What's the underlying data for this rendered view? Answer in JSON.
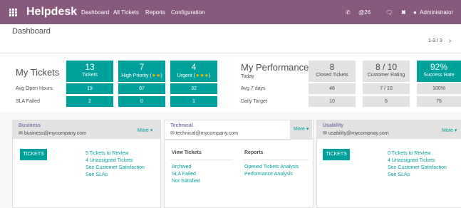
{
  "topbar": {
    "brand": "Helpdesk",
    "menu": [
      "Dashboard",
      "All Tickets",
      "Reports",
      "Configuration"
    ],
    "phone_icon": "phone-icon",
    "activity_count": "@26",
    "chat_icon": "chat-icon",
    "close_icon": "close-icon",
    "user": "Administrator"
  },
  "subhead": {
    "title": "Dashboard",
    "pager": "1-3 / 3"
  },
  "my_tickets": {
    "title": "My Tickets",
    "tiles": [
      {
        "num": "13",
        "label": "Tickets"
      },
      {
        "num": "7",
        "label": "High Priority",
        "stars": "★★"
      },
      {
        "num": "4",
        "label": "Urgent",
        "stars": "★★★"
      }
    ],
    "rows": [
      {
        "label": "Avg Open Hours",
        "values": [
          "19",
          "87",
          "32"
        ]
      },
      {
        "label": "SLA Failed",
        "values": [
          "2",
          "0",
          "1"
        ]
      }
    ]
  },
  "my_performance": {
    "title": "My Performance",
    "subtitle": "Today",
    "tiles": [
      {
        "num": "8",
        "label": "Closed Tickets"
      },
      {
        "num": "8 / 10",
        "label": "Customer Rating"
      },
      {
        "num": "92%",
        "label": "Success Rate"
      }
    ],
    "rows": [
      {
        "label": "Avg 7 days",
        "values": [
          "46",
          "7 / 10",
          "100%"
        ]
      },
      {
        "label": "Daily Target",
        "values": [
          "10",
          "5",
          "75"
        ]
      }
    ]
  },
  "teams": [
    {
      "name": "Business",
      "email": "business@mycompany.com",
      "more": "More ▾",
      "button": "TICKETS",
      "links": [
        "5 Tickets to Review",
        "4 Unassigned Tickets",
        "See Customer Satisfaction",
        "See SLAs"
      ]
    },
    {
      "name": "Technical",
      "email": "technical@mycompany.com",
      "more": "More ▾",
      "view_heading": "View Tickets",
      "view_links": [
        "Archived",
        "SLA Failed",
        "Not Satisfied"
      ],
      "reports_heading": "Reports",
      "reports_links": [
        "Opened Tickets Analysis",
        "Performance Analysis"
      ]
    },
    {
      "name": "Usability",
      "email": "usability@mycompnay.com",
      "more": "More ▾",
      "button": "TICKETS",
      "links": [
        "0 Tickets to Review",
        "4 Unassigned Tickets",
        "See Customer Satisfaction",
        "See SLAs"
      ]
    }
  ]
}
